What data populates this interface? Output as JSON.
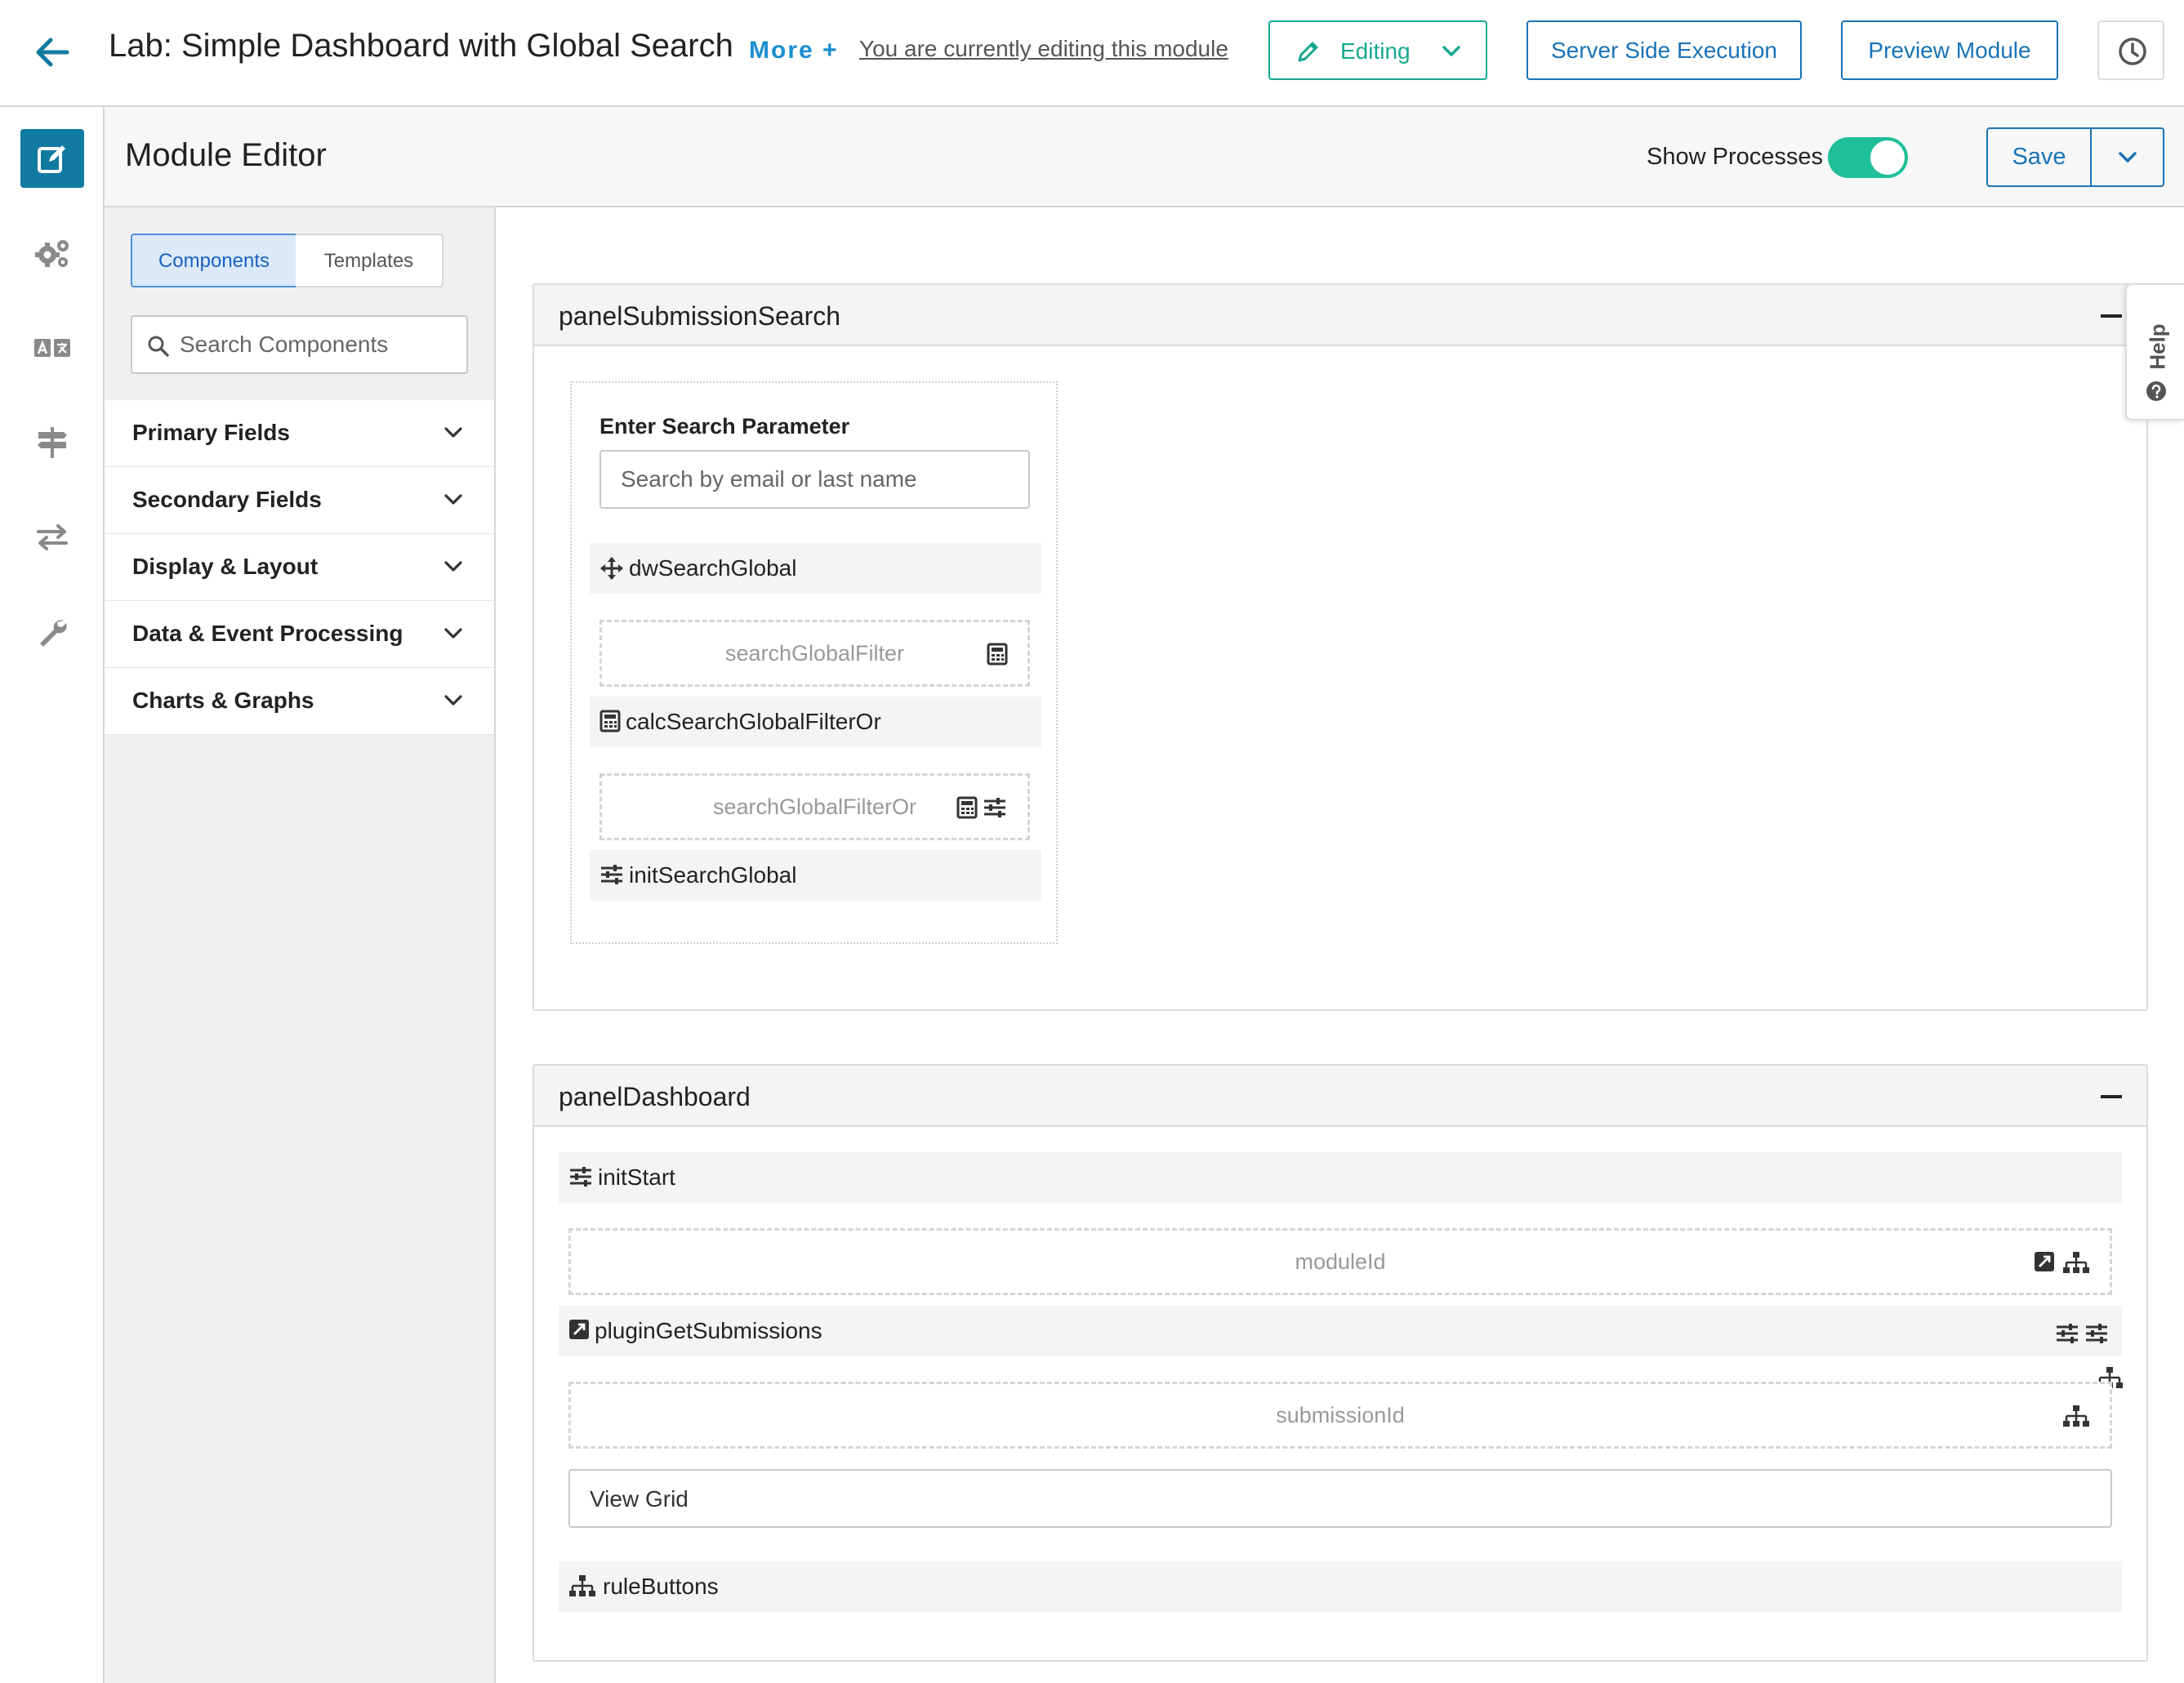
{
  "header": {
    "title": "Lab: Simple Dashboard with Global Search",
    "more_label": "More +",
    "editing_note": "You are currently editing this module",
    "editing_label": "Editing",
    "server_side_label": "Server Side Execution",
    "preview_label": "Preview Module"
  },
  "subheader": {
    "title": "Module Editor",
    "show_processes_label": "Show Processes",
    "show_processes_on": true,
    "save_label": "Save"
  },
  "sidebar": {
    "tabs": [
      "Components",
      "Templates"
    ],
    "active_tab": "Components",
    "search_placeholder": "Search Components",
    "categories": [
      "Primary Fields",
      "Secondary Fields",
      "Display & Layout",
      "Data & Event Processing",
      "Charts & Graphs"
    ]
  },
  "panel_search": {
    "title": "panelSubmissionSearch",
    "field_label": "Enter Search Parameter",
    "field_placeholder": "Search by email or last name",
    "dw_search_global": "dwSearchGlobal",
    "search_global_filter": "searchGlobalFilter",
    "calc_search_global_filter_or": "calcSearchGlobalFilterOr",
    "search_global_filter_or": "searchGlobalFilterOr",
    "init_search_global": "initSearchGlobal"
  },
  "panel_dashboard": {
    "title": "panelDashboard",
    "init_start": "initStart",
    "module_id": "moduleId",
    "plugin_get_submissions": "pluginGetSubmissions",
    "submission_id": "submissionId",
    "view_grid": "View Grid",
    "rule_buttons": "ruleButtons"
  },
  "help_label": "Help",
  "colors": {
    "accent_teal": "#16a98f",
    "primary_blue": "#1a73b5",
    "rail_active": "#117aa0",
    "toggle_on": "#1fbf9a"
  }
}
